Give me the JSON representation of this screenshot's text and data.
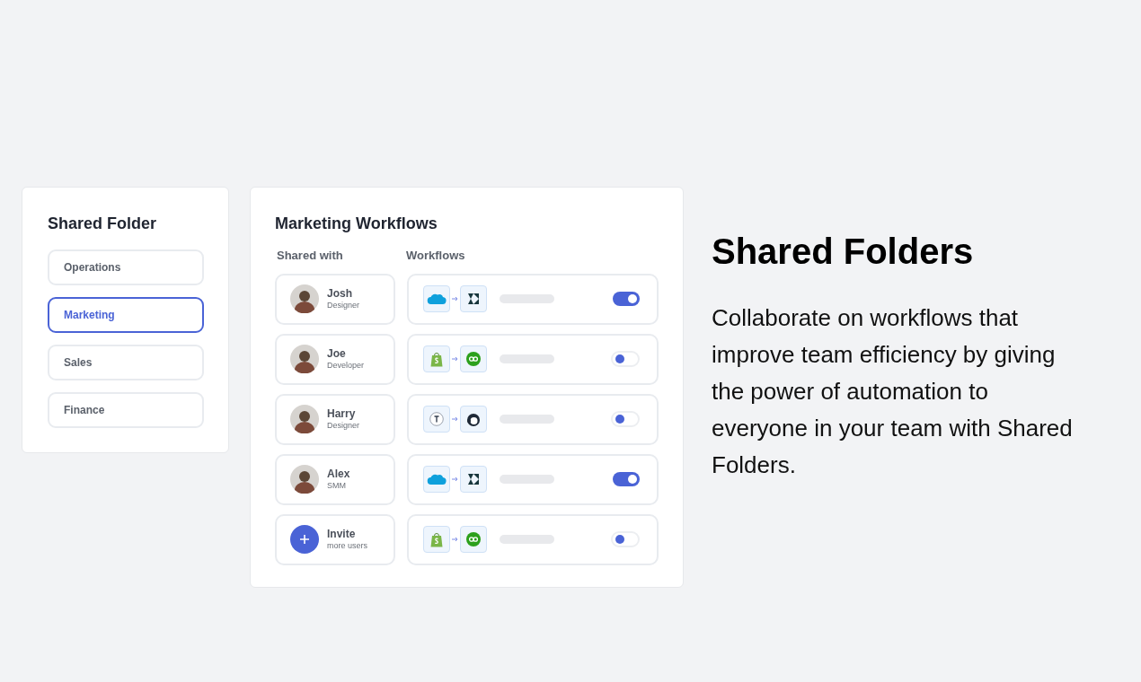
{
  "folders": {
    "title": "Shared Folder",
    "items": [
      {
        "label": "Operations",
        "selected": false
      },
      {
        "label": "Marketing",
        "selected": true
      },
      {
        "label": "Sales",
        "selected": false
      },
      {
        "label": "Finance",
        "selected": false
      }
    ]
  },
  "workflows": {
    "title": "Marketing Workflows",
    "columns": [
      "Shared with",
      "Workflows"
    ],
    "rows": [
      {
        "user": {
          "kind": "person",
          "name": "Josh",
          "role": "Designer"
        },
        "workflow": {
          "kind": "cloud-to-z",
          "on": true
        }
      },
      {
        "user": {
          "kind": "person",
          "name": "Joe",
          "role": "Developer"
        },
        "workflow": {
          "kind": "bag-to-circle",
          "on": false
        }
      },
      {
        "user": {
          "kind": "person",
          "name": "Harry",
          "role": "Designer"
        },
        "workflow": {
          "kind": "t-to-head",
          "on": false
        }
      },
      {
        "user": {
          "kind": "person",
          "name": "Alex",
          "role": "SMM"
        },
        "workflow": {
          "kind": "cloud-to-z",
          "on": true
        }
      },
      {
        "user": {
          "kind": "invite",
          "name": "Invite",
          "role": "more users"
        },
        "workflow": {
          "kind": "bag-to-circle",
          "on": false
        }
      }
    ]
  },
  "feature": {
    "title": "Shared Folders",
    "description": "Collaborate on workflows that improve team efficiency by giving the power of automation to everyone in your team with Shared Folders."
  }
}
